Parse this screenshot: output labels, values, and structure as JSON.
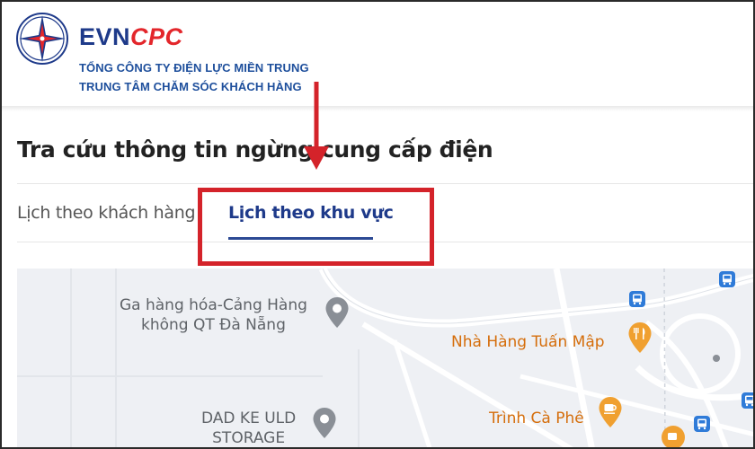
{
  "header": {
    "brand_evn": "EVN",
    "brand_cpc": "CPC",
    "company_line1": "TỔNG CÔNG TY ĐIỆN LỰC MIỀN TRUNG",
    "company_line2": "TRUNG TÂM CHĂM SÓC KHÁCH HÀNG"
  },
  "page": {
    "title": "Tra cứu thông tin ngừng cung cấp điện"
  },
  "tabs": [
    {
      "label": "Lịch theo khách hàng",
      "active": false
    },
    {
      "label": "Lịch theo khu vực",
      "active": true
    }
  ],
  "map": {
    "places": [
      {
        "line1": "Ga hàng hóa-Cảng Hàng",
        "line2": "không QT Đà Nẵng",
        "icon": "pin-icon"
      },
      {
        "line1": "DAD KE ULD",
        "line2": "STORAGE",
        "icon": "pin-icon"
      },
      {
        "line1": "Nhà Hàng Tuấn Mập",
        "icon": "restaurant-icon"
      },
      {
        "line1": "Trình Cà Phê",
        "icon": "coffee-icon"
      }
    ]
  },
  "colors": {
    "brand_blue": "#1e3a8a",
    "brand_red": "#e3262b",
    "annotation_red": "#d4232a",
    "map_background": "#eef0f4",
    "poi_orange": "#f0a030"
  }
}
